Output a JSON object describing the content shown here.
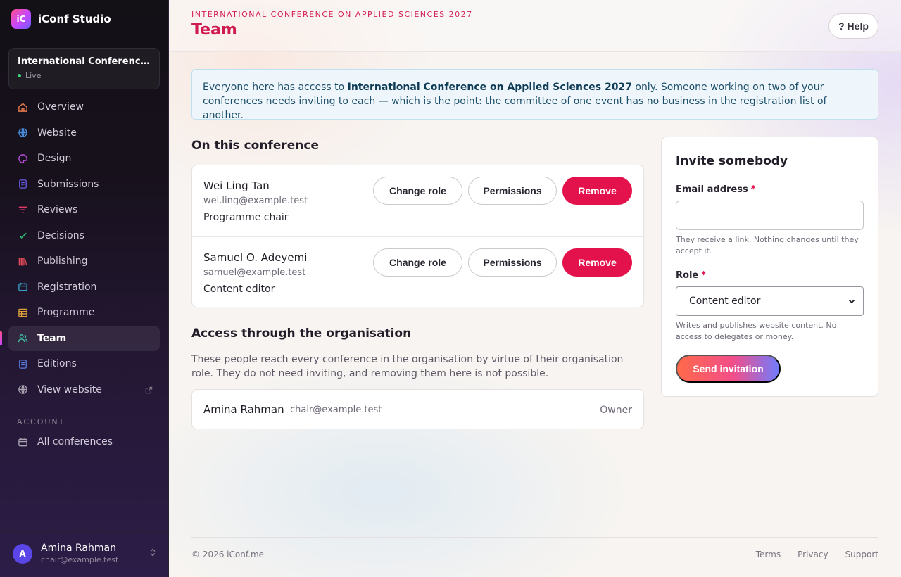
{
  "app": {
    "logo_text": "iC",
    "name": "iConf Studio"
  },
  "conference": {
    "name": "International Conference on Applied Sciences 2027",
    "status": "Live"
  },
  "nav": [
    {
      "label": "Overview",
      "icon": "home-icon",
      "color": "#e0784a"
    },
    {
      "label": "Website",
      "icon": "globe-icon",
      "color": "#4a8fe0"
    },
    {
      "label": "Design",
      "icon": "palette-icon",
      "color": "#b64ad8"
    },
    {
      "label": "Submissions",
      "icon": "document-icon",
      "color": "#6a5ce6"
    },
    {
      "label": "Reviews",
      "icon": "filter-icon",
      "color": "#e03a6a"
    },
    {
      "label": "Decisions",
      "icon": "check-icon",
      "color": "#34c47a"
    },
    {
      "label": "Publishing",
      "icon": "books-icon",
      "color": "#e04a5a"
    },
    {
      "label": "Registration",
      "icon": "ticket-icon",
      "color": "#38a3c9"
    },
    {
      "label": "Programme",
      "icon": "table-icon",
      "color": "#e0a23a"
    },
    {
      "label": "Team",
      "icon": "users-icon",
      "color": "#3fc9a6",
      "active": true
    },
    {
      "label": "Editions",
      "icon": "editions-icon",
      "color": "#5a7ee0"
    },
    {
      "label": "View website",
      "icon": "globe-icon",
      "color": "#a8a2b0",
      "external": true
    }
  ],
  "account": {
    "section_label": "ACCOUNT",
    "items": [
      {
        "label": "All conferences",
        "icon": "calendar-icon"
      }
    ]
  },
  "user": {
    "initial": "A",
    "name": "Amina Rahman",
    "email": "chair@example.test"
  },
  "header": {
    "eyebrow": "INTERNATIONAL CONFERENCE ON APPLIED SCIENCES 2027",
    "title": "Team",
    "help_label": "? Help"
  },
  "notice": {
    "prefix": "Everyone here has access to ",
    "conference": "International Conference on Applied Sciences 2027",
    "suffix": " only. Someone working on two of your conferences needs inviting to each — which is the point: the committee of one event has no business in the registration list of another."
  },
  "on_conference": {
    "heading": "On this conference",
    "actions": {
      "change_role": "Change role",
      "permissions": "Permissions",
      "remove": "Remove"
    },
    "members": [
      {
        "name": "Wei Ling Tan",
        "email": "wei.ling@example.test",
        "role": "Programme chair"
      },
      {
        "name": "Samuel O. Adeyemi",
        "email": "samuel@example.test",
        "role": "Content editor"
      }
    ]
  },
  "organisation": {
    "heading": "Access through the organisation",
    "description": "These people reach every conference in the organisation by virtue of their organisation role. They do not need inviting, and removing them here is not possible.",
    "members": [
      {
        "name": "Amina Rahman",
        "email": "chair@example.test",
        "role": "Owner"
      }
    ]
  },
  "invite": {
    "title": "Invite somebody",
    "email_label": "Email address",
    "email_value": "",
    "email_placeholder": "",
    "email_hint": "They receive a link. Nothing changes until they accept it.",
    "role_label": "Role",
    "role_value": "Content editor",
    "role_hint": "Writes and publishes website content. No access to delegates or money.",
    "submit_label": "Send invitation",
    "required_marker": "*"
  },
  "footer": {
    "copyright": "© 2026 iConf.me",
    "links": [
      "Terms",
      "Privacy",
      "Support"
    ]
  },
  "colors": {
    "accent": "#d01b52",
    "danger": "#e3114c",
    "notice_bg": "#eef6fb",
    "live": "#3ad17b"
  }
}
